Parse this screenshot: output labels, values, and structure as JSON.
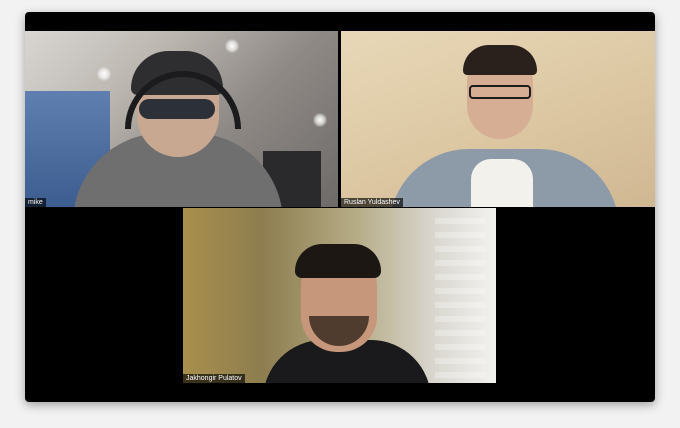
{
  "meeting": {
    "participants": [
      {
        "name": "mike"
      },
      {
        "name": "Ruslan Yuldashev"
      },
      {
        "name": "Jakhongir Pulatov"
      }
    ]
  }
}
